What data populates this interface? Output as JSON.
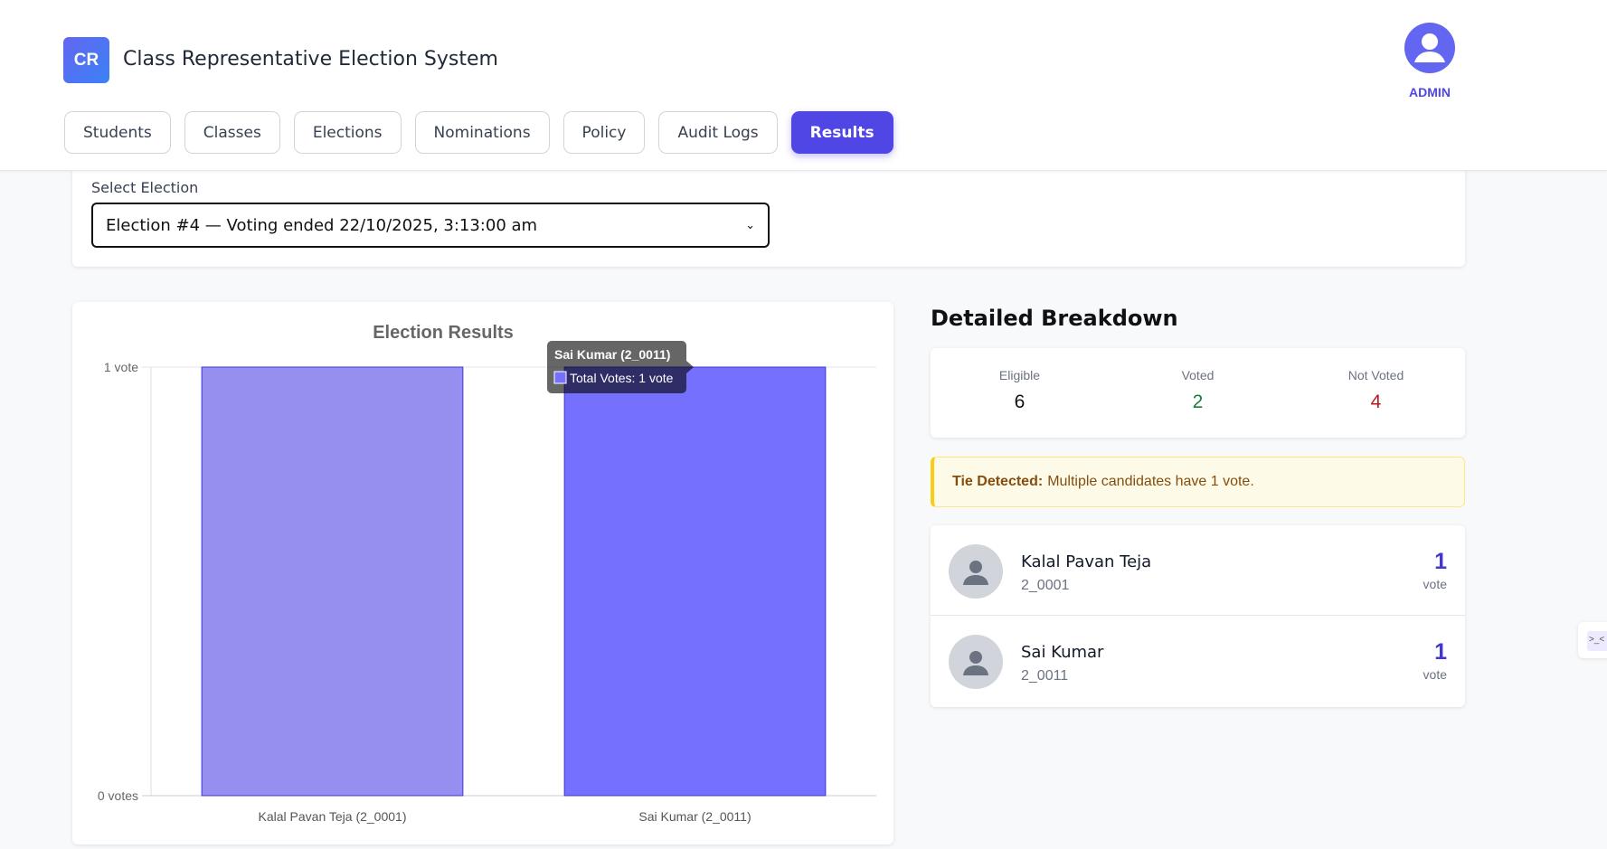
{
  "header": {
    "logo": "CR",
    "title": "Class Representative Election System",
    "user_role": "ADMIN"
  },
  "tabs": [
    {
      "label": "Students"
    },
    {
      "label": "Classes"
    },
    {
      "label": "Elections"
    },
    {
      "label": "Nominations"
    },
    {
      "label": "Policy"
    },
    {
      "label": "Audit Logs"
    },
    {
      "label": "Results",
      "active": true
    }
  ],
  "election_select": {
    "label": "Select Election",
    "value": "Election #4 — Voting ended 22/10/2025, 3:13:00 am"
  },
  "chart_data": {
    "type": "bar",
    "title": "Election Results",
    "categories": [
      "Kalal Pavan Teja  (2_0001)",
      "Sai Kumar (2_0011)"
    ],
    "series": [
      {
        "name": "Total Votes",
        "values": [
          1,
          1
        ]
      }
    ],
    "ylim": [
      0,
      1
    ],
    "y_ticks": [
      "0 votes",
      "1 vote"
    ],
    "colors": [
      "#978ff0",
      "#7670ff"
    ],
    "tooltip": {
      "title": "Sai Kumar (2_0011)",
      "body": "Total Votes: 1 vote"
    }
  },
  "breakdown": {
    "title": "Detailed Breakdown",
    "stats": [
      {
        "label": "Eligible",
        "value": "6",
        "color": "#111111"
      },
      {
        "label": "Voted",
        "value": "2",
        "color": "#15803d"
      },
      {
        "label": "Not Voted",
        "value": "4",
        "color": "#b91c1c"
      }
    ],
    "tie": {
      "strong": "Tie Detected:",
      "text": "Multiple candidates have 1 vote."
    },
    "candidates": [
      {
        "name": "Kalal Pavan Teja",
        "id": "2_0001",
        "votes": "1",
        "unit": "vote"
      },
      {
        "name": "Sai Kumar",
        "id": "2_0011",
        "votes": "1",
        "unit": "vote"
      }
    ]
  },
  "side_widget": ">_<"
}
